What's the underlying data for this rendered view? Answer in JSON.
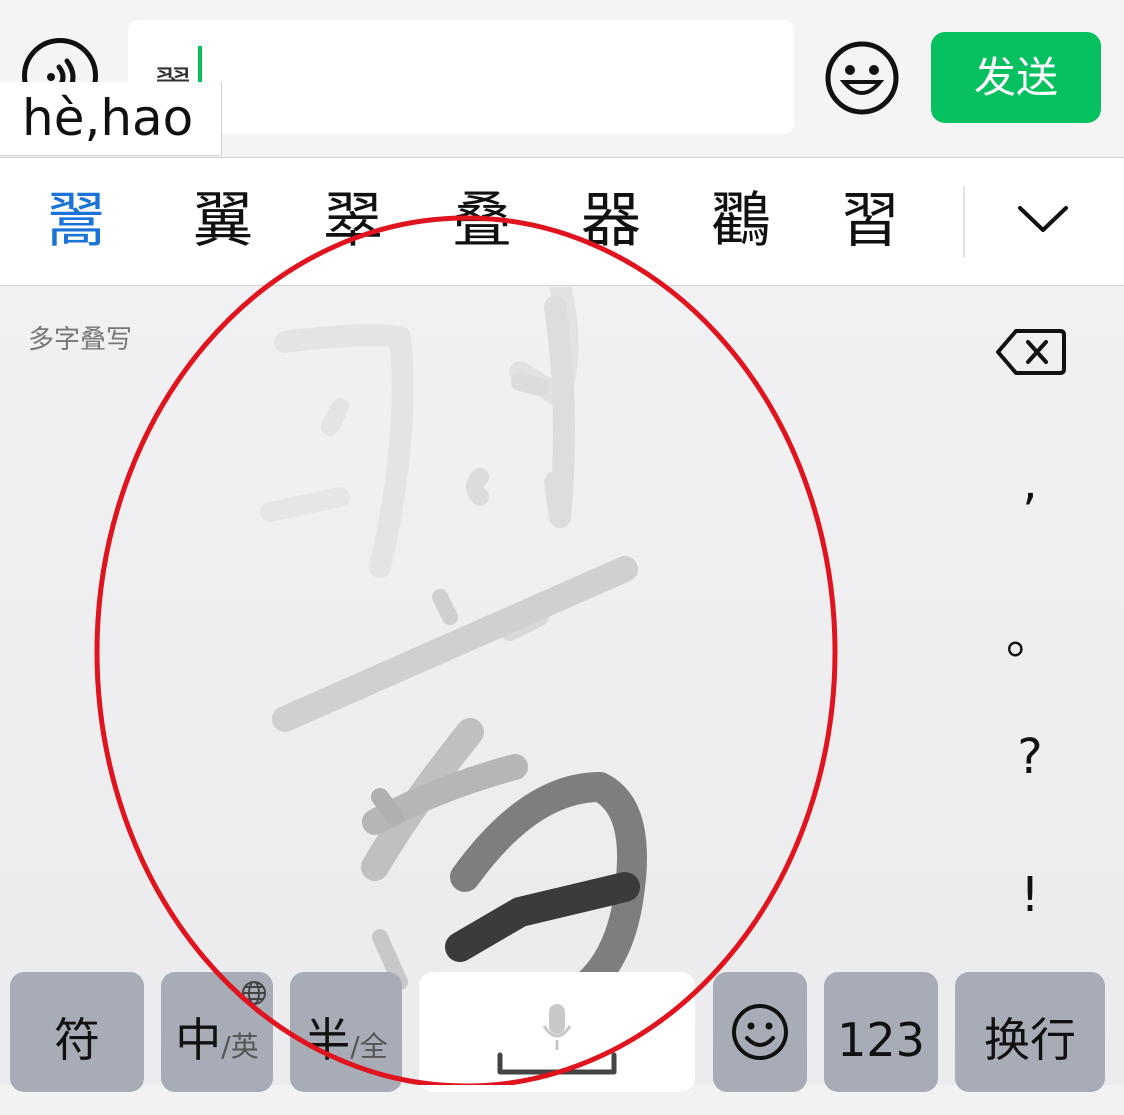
{
  "input": {
    "text": "翯",
    "pinyin": "hè,hao"
  },
  "send_label": "发送",
  "candidates": [
    "翯",
    "翼",
    "翠",
    "叠",
    "器",
    "鸐",
    "習"
  ],
  "handwriting": {
    "mode_label": "多字叠写"
  },
  "side_keys": [
    ",",
    "。",
    "?",
    "!"
  ],
  "bottom_keys": {
    "symbols": "符",
    "zh": "中",
    "en": "/英",
    "half": "半",
    "full": "/全",
    "numbers": "123",
    "newline": "换行"
  },
  "colors": {
    "send_bg": "#07c160",
    "selected_candidate": "#1a73d9",
    "annotation": "#e0141e"
  }
}
